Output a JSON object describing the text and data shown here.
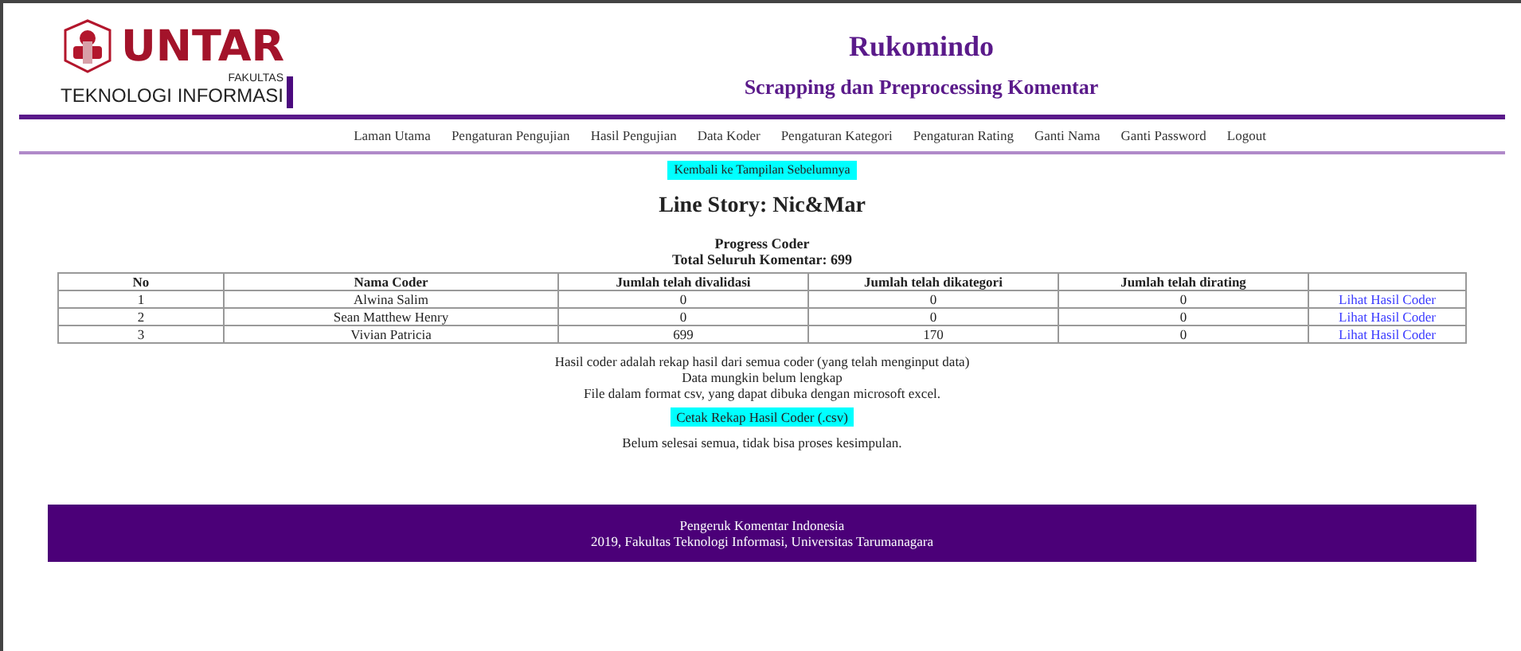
{
  "logo": {
    "name": "UNTAR",
    "faculty_label": "FAKULTAS",
    "faculty": "TEKNOLOGI INFORMASI"
  },
  "header": {
    "title": "Rukomindo",
    "subtitle": "Scrapping dan Preprocessing Komentar"
  },
  "nav": [
    "Laman Utama",
    "Pengaturan Pengujian",
    "Hasil Pengujian",
    "Data Koder",
    "Pengaturan Kategori",
    "Pengaturan Rating",
    "Ganti Nama",
    "Ganti Password",
    "Logout"
  ],
  "back_button": "Kembali ke Tampilan Sebelumnya",
  "heading": "Line Story: Nic&Mar",
  "progress_title": "Progress Coder",
  "total": "Total Seluruh Komentar: 699",
  "table": {
    "columns": [
      "No",
      "Nama Coder",
      "Jumlah telah divalidasi",
      "Jumlah telah dikategori",
      "Jumlah telah dirating"
    ],
    "rows": [
      {
        "no": "1",
        "name": "Alwina Salim",
        "validated": "0",
        "categorized": "0",
        "rated": "0",
        "link": "Lihat Hasil Coder"
      },
      {
        "no": "2",
        "name": "Sean Matthew Henry",
        "validated": "0",
        "categorized": "0",
        "rated": "0",
        "link": "Lihat Hasil Coder"
      },
      {
        "no": "3",
        "name": "Vivian Patricia",
        "validated": "699",
        "categorized": "170",
        "rated": "0",
        "link": "Lihat Hasil Coder"
      }
    ]
  },
  "notes": [
    "Hasil coder adalah rekap hasil dari semua coder (yang telah menginput data)",
    "Data mungkin belum lengkap",
    "File dalam format csv, yang dapat dibuka dengan microsoft excel."
  ],
  "export_button": "Cetak Rekap Hasil Coder (.csv)",
  "status": "Belum selesai semua, tidak bisa proses kesimpulan.",
  "footer": [
    "Pengeruk Komentar Indonesia",
    "2019, Fakultas Teknologi Informasi, Universitas Tarumanagara"
  ]
}
